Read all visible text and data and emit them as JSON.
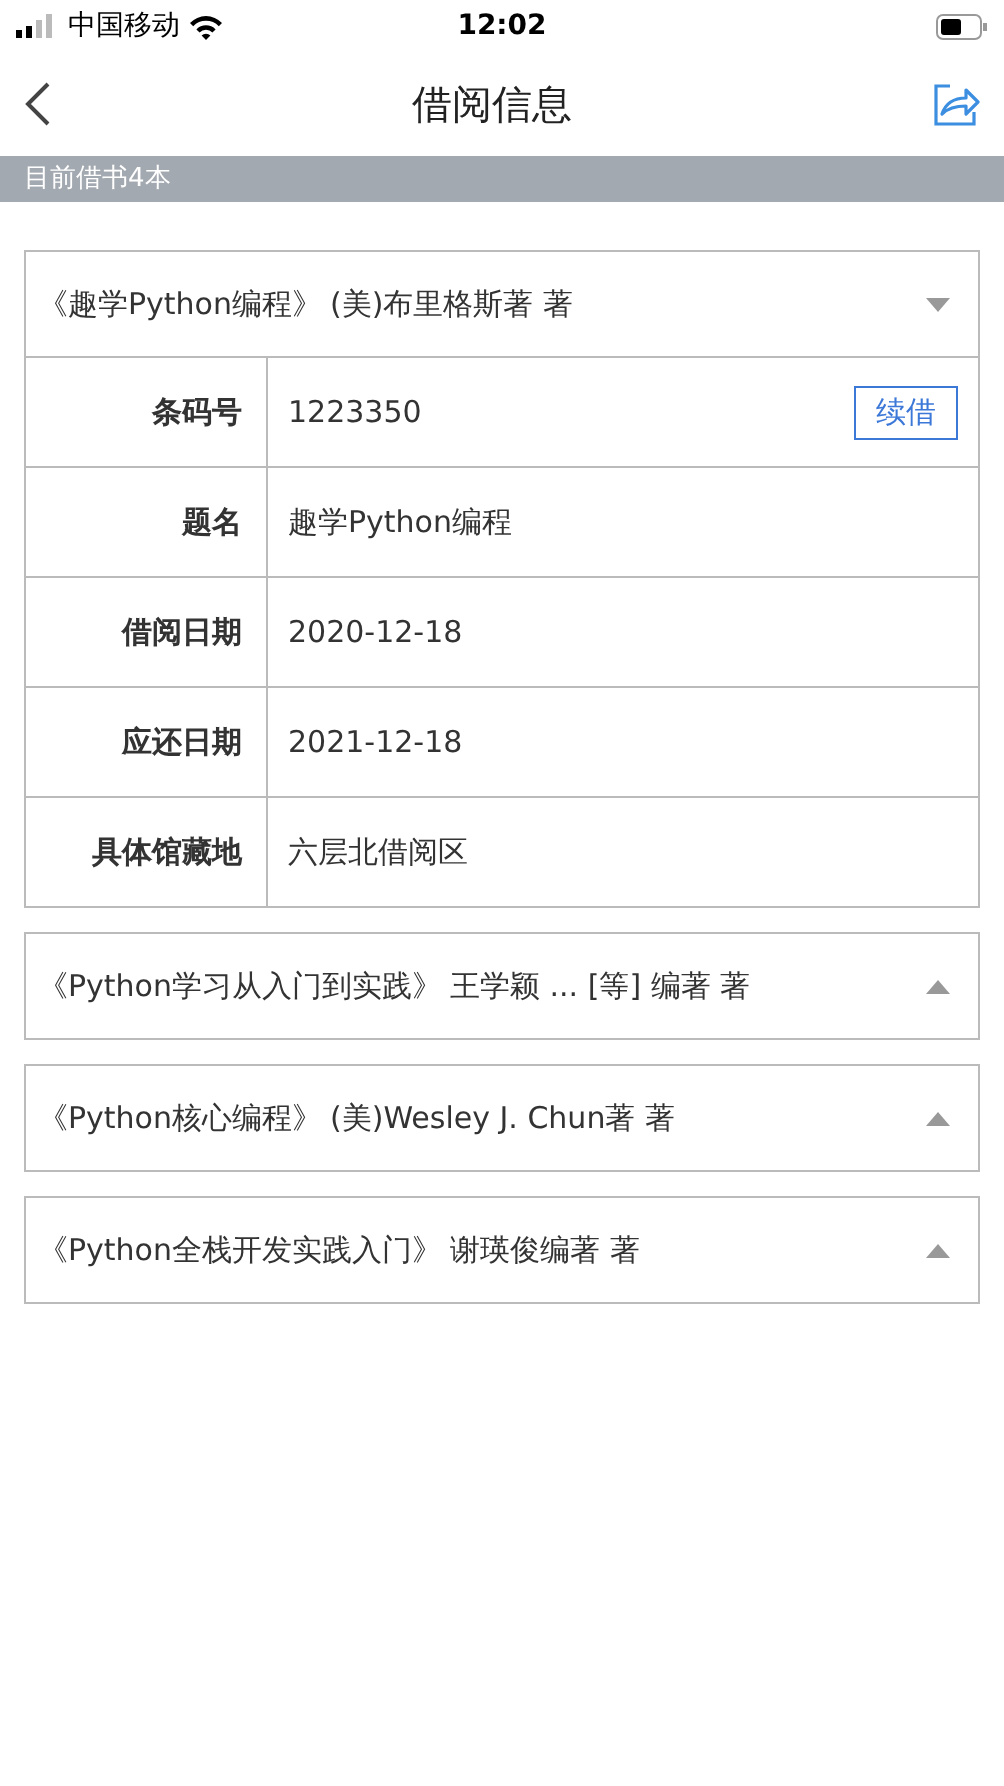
{
  "status_bar": {
    "carrier": "中国移动",
    "time": "12:02"
  },
  "nav": {
    "title": "借阅信息"
  },
  "banner": "目前借书4本",
  "books": [
    {
      "title": "《趣学Python编程》",
      "author": "(美)布里格斯著 著",
      "expanded": true,
      "details": [
        {
          "label": "条码号",
          "value": "1223350",
          "action": "续借"
        },
        {
          "label": "题名",
          "value": "趣学Python编程"
        },
        {
          "label": "借阅日期",
          "value": "2020-12-18"
        },
        {
          "label": "应还日期",
          "value": "2021-12-18"
        },
        {
          "label": "具体馆藏地",
          "value": "六层北借阅区"
        }
      ]
    },
    {
      "title": "《Python学习从入门到实践》",
      "author": "王学颖 ... [等] 编著 著",
      "expanded": false
    },
    {
      "title": "《Python核心编程》",
      "author": "(美)Wesley J. Chun著 著",
      "expanded": false
    },
    {
      "title": "《Python全栈开发实践入门》",
      "author": "谢瑛俊编著 著",
      "expanded": false
    }
  ]
}
